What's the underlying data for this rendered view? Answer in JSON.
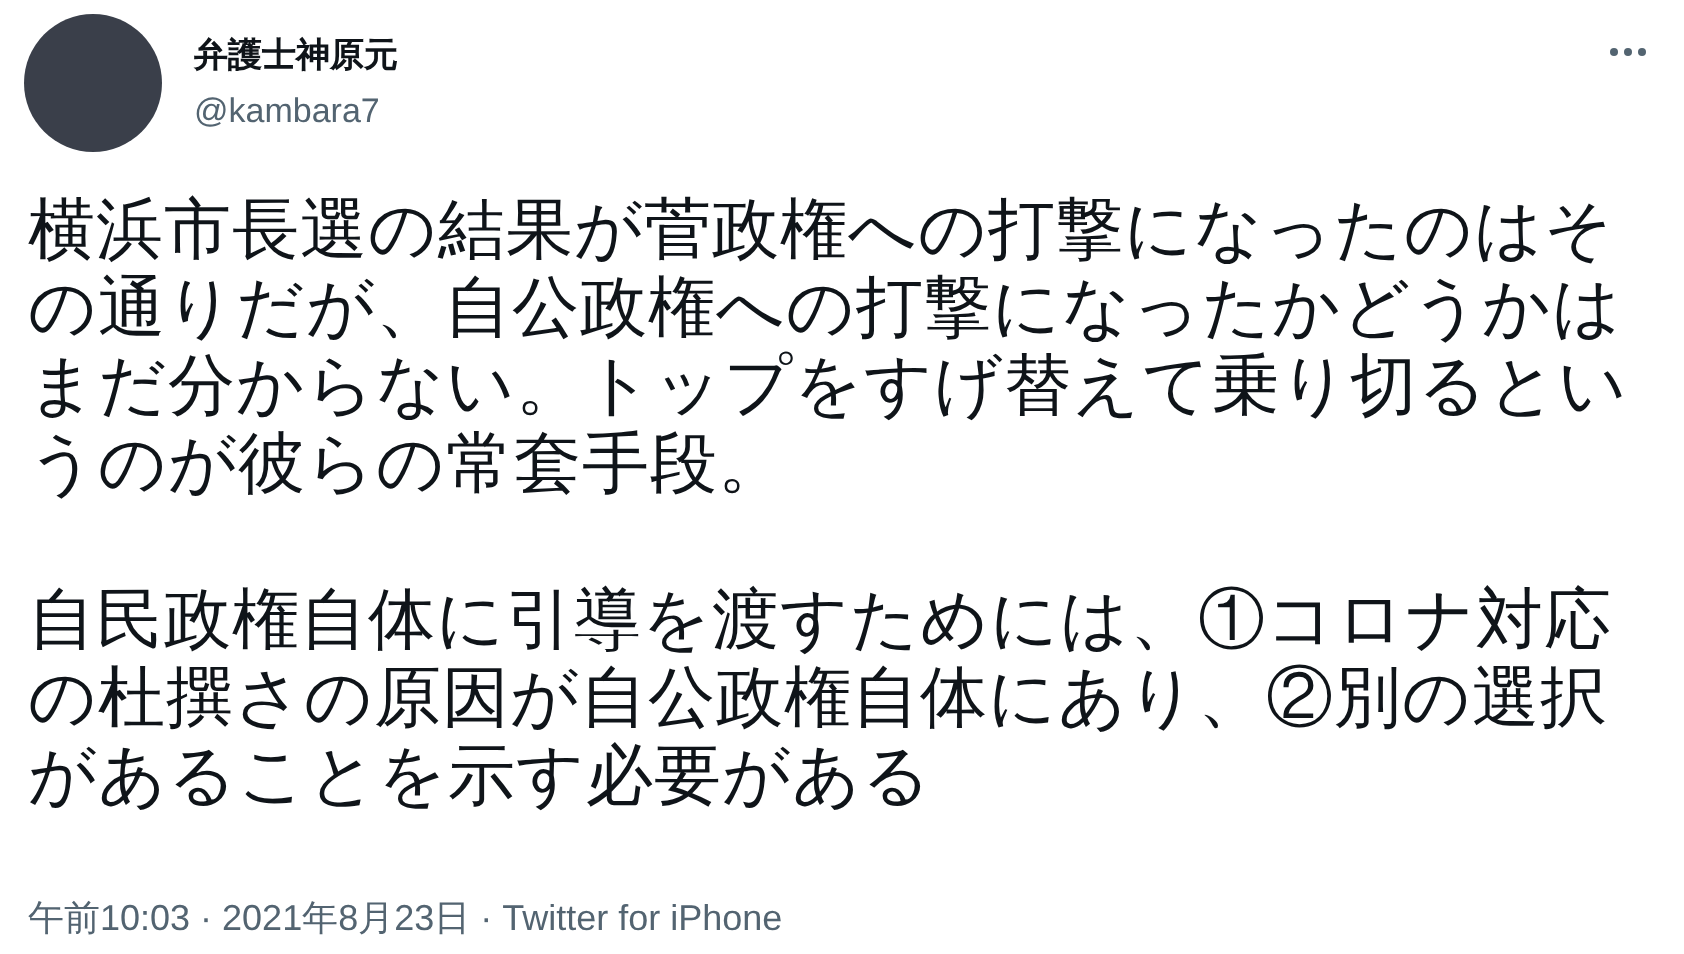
{
  "author": {
    "name": "弁護士神原元",
    "handle": "@kambara7"
  },
  "paragraphs": [
    "横浜市長選の結果が菅政権への打撃になったのはその通りだが、自公政権への打撃になったかどうかはまだ分からない。トップをすげ替えて乗り切るというのが彼らの常套手段。",
    "自民政権自体に引導を渡すためには、①コロナ対応の杜撰さの原因が自公政権自体にあり、②別の選択があることを示す必要がある"
  ],
  "footer": "午前10:03 · 2021年8月23日 · Twitter for iPhone"
}
